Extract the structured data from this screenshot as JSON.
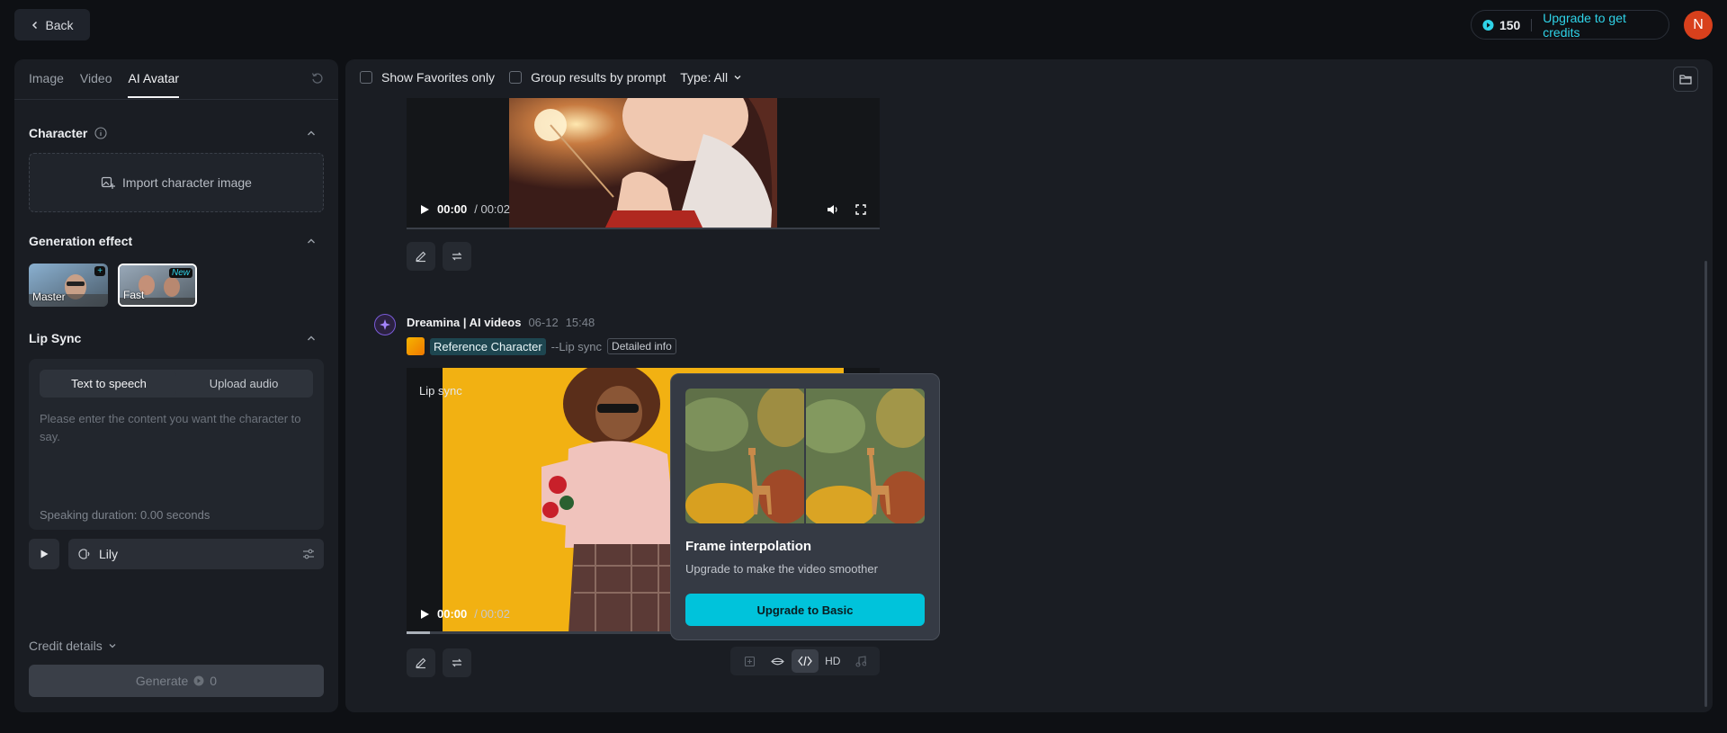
{
  "topbar": {
    "back_label": "Back",
    "credits": "150",
    "upgrade_label": "Upgrade to get credits",
    "avatar_initial": "N"
  },
  "left": {
    "tabs": [
      {
        "label": "Image"
      },
      {
        "label": "Video"
      },
      {
        "label": "AI Avatar",
        "active": true
      }
    ],
    "character": {
      "title": "Character",
      "import_label": "Import character image"
    },
    "generation_effect": {
      "title": "Generation effect",
      "options": [
        {
          "label": "Master",
          "badge": "+"
        },
        {
          "label": "Fast",
          "badge": "New",
          "selected": true
        }
      ]
    },
    "lip_sync": {
      "title": "Lip Sync",
      "modes": [
        "Text to speech",
        "Upload audio"
      ],
      "active_mode": "Text to speech",
      "placeholder": "Please enter the content you want the character to say.",
      "duration": "Speaking duration: 0.00 seconds",
      "voice": "Lily"
    },
    "credit_details": "Credit details",
    "generate_label": "Generate",
    "generate_cost": "0"
  },
  "main": {
    "filters": {
      "favorites": "Show Favorites only",
      "group": "Group results by prompt",
      "type": "Type: All"
    },
    "video1": {
      "time": "00:00",
      "duration": "/ 00:02"
    },
    "item2": {
      "author": "Dreamina | AI videos",
      "date": "06-12",
      "time": "15:48",
      "reference_tag": "Reference Character",
      "mode": "--Lip sync",
      "detail_label": "Detailed info",
      "video_label": "Lip sync",
      "video_time": "00:00",
      "video_duration": "/ 00:02",
      "progress": 0.05,
      "hd_label": "HD"
    }
  },
  "popup": {
    "title": "Frame interpolation",
    "subtitle": "Upgrade to make the video smoother",
    "button": "Upgrade to Basic"
  },
  "colors": {
    "accent": "#00c3db",
    "avatar": "#d8401c",
    "panel": "#1a1d23"
  }
}
